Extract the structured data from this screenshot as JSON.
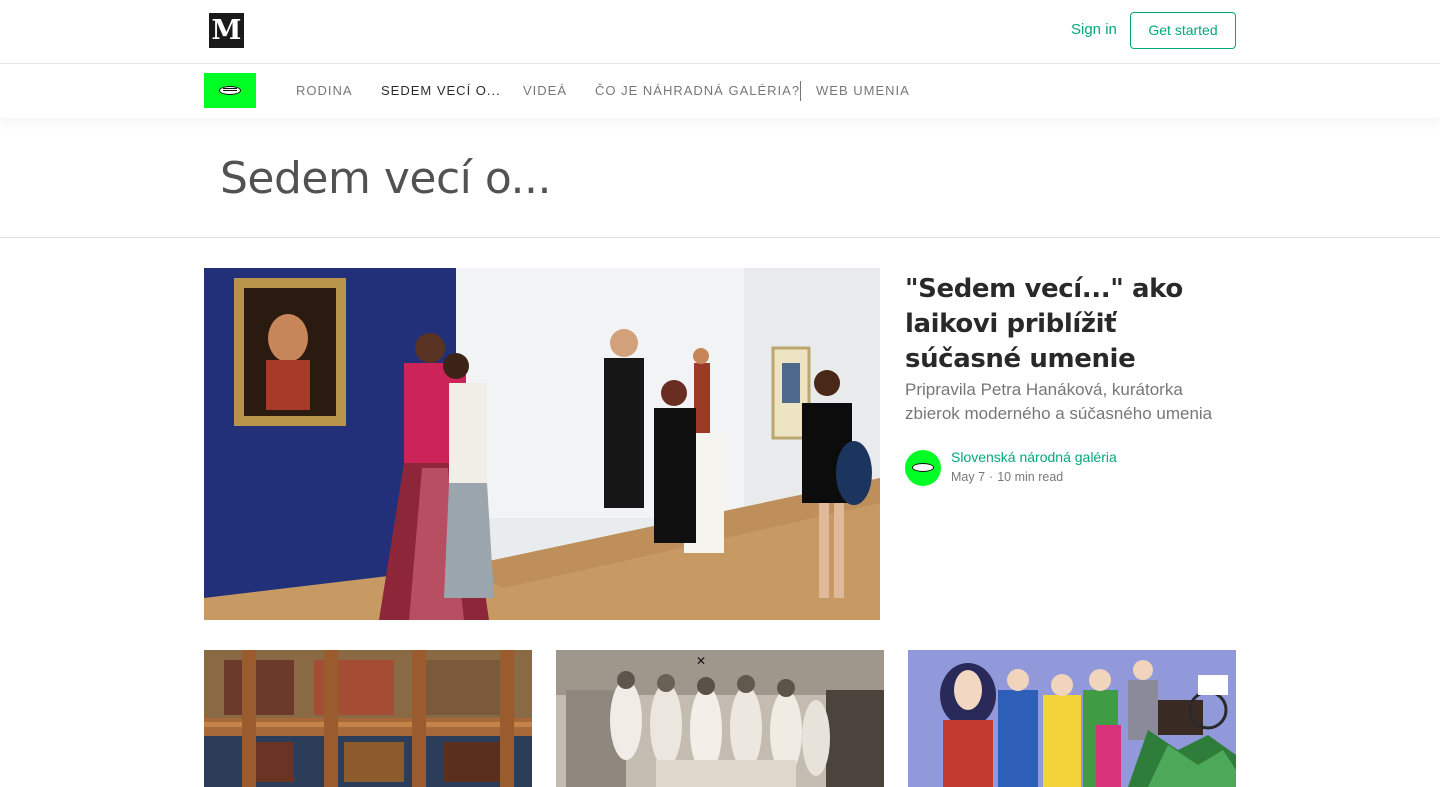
{
  "header": {
    "logo_letter": "M",
    "sign_in": "Sign in",
    "get_started": "Get started"
  },
  "publication_nav": {
    "items": [
      {
        "label": "RODINA",
        "active": false
      },
      {
        "label": "SEDEM VECÍ O...",
        "active": true
      },
      {
        "label": "VIDEÁ",
        "active": false
      },
      {
        "label": "ČO JE NÁHRADNÁ GALÉRIA?",
        "active": false
      },
      {
        "label": "WEB UMENIA",
        "active": false
      }
    ],
    "brand_color": "#00ff24"
  },
  "section": {
    "title": "Sedem vecí o..."
  },
  "featured": {
    "title": "\"Sedem vecí...\" ako laikovi priblížiť súčasné umenie",
    "subtitle": "Pripravila Petra Hanáková, kurátorka zbierok moderného a súčasného umenia",
    "author": "Slovenská národná galéria",
    "date": "May 7",
    "read_time": "10 min read",
    "image": "gallery-visitors-photo"
  },
  "cards": [
    {
      "image": "painted-ceiling-photo"
    },
    {
      "image": "historic-nurses-photo"
    },
    {
      "image": "folk-painting-figures"
    }
  ],
  "colors": {
    "accent": "#03a87c",
    "publication_green": "#00ff24"
  }
}
